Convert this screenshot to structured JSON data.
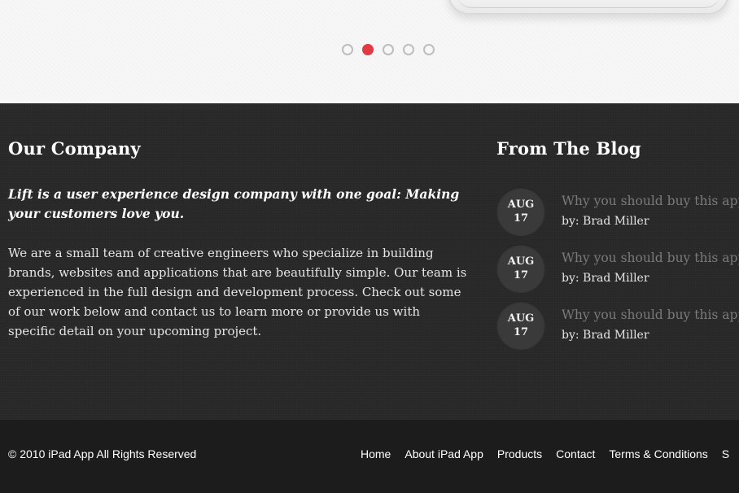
{
  "slider": {
    "dots": [
      {
        "active": false
      },
      {
        "active": true
      },
      {
        "active": false
      },
      {
        "active": false
      },
      {
        "active": false
      }
    ],
    "accent_color": "#e23a45"
  },
  "company": {
    "heading": "Our Company",
    "intro": "Lift is a user experience design company with one goal: Making your customers love you.",
    "body": "We are a small team of creative engineers who specialize in building brands, websites and applications that are beautifully simple. Our team is experienced in the full design and development process. Check out some of our work below and contact us to learn more or provide us with specific detail on your upcoming project."
  },
  "blog": {
    "heading": "From The Blog",
    "posts": [
      {
        "month": "AUG",
        "day": "17",
        "title": "Why you should buy this app",
        "author": "by: Brad Miller"
      },
      {
        "month": "AUG",
        "day": "17",
        "title": "Why you should buy this app",
        "author": "by: Brad Miller"
      },
      {
        "month": "AUG",
        "day": "17",
        "title": "Why you should buy this app",
        "author": "by: Brad Miller"
      }
    ]
  },
  "footer": {
    "copyright": "© 2010 iPad App All Rights Reserved",
    "nav": [
      "Home",
      "About iPad App",
      "Products",
      "Contact",
      "Terms & Conditions",
      "S"
    ]
  }
}
